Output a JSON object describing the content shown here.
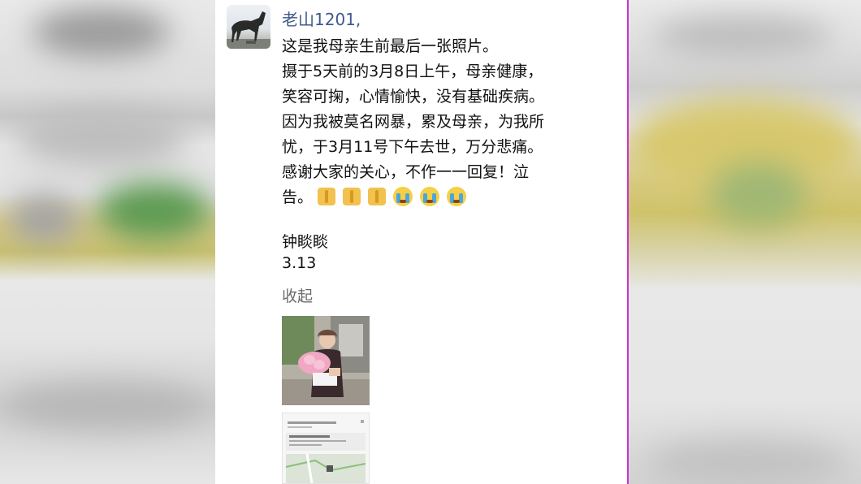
{
  "post": {
    "author": "老山1201,",
    "lines": [
      "这是我母亲生前最后一张照片。",
      "摄于5天前的3月8日上午，母亲健康，",
      "笑容可掬，心情愉快，没有基础疾病。",
      "因为我被莫名网暴，累及母亲，为我所",
      "忧，于3月11号下午去世，万分悲痛。",
      "感谢大家的关心，不作一一回复！泣",
      "告。"
    ],
    "emoji": [
      "pray",
      "pray",
      "pray",
      "cry",
      "cry",
      "cry"
    ],
    "signature": "钟睒睒",
    "date": "3.13",
    "collapse_label": "收起"
  },
  "colors": {
    "author": "#3e5a8a",
    "side_border": "#cc33cc",
    "collapse": "#6b6b6b"
  }
}
